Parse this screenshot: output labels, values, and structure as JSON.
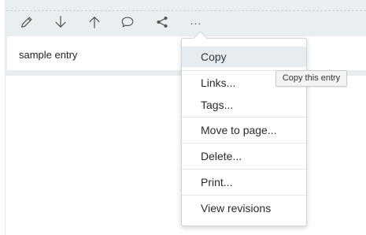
{
  "toolbar": {
    "edit_icon": "pencil-icon",
    "move_down_icon": "arrow-down-icon",
    "move_up_icon": "arrow-up-icon",
    "comment_icon": "speech-bubble-icon",
    "share_icon": "share-icon",
    "more_label": "..."
  },
  "entry": {
    "text": "sample entry"
  },
  "menu": {
    "items": [
      {
        "label": "Copy"
      },
      {
        "label": "Links..."
      },
      {
        "label": "Tags..."
      },
      {
        "label": "Move to page..."
      },
      {
        "label": "Delete..."
      },
      {
        "label": "Print..."
      },
      {
        "label": "View revisions"
      }
    ]
  },
  "tooltip": {
    "text": "Copy this entry"
  },
  "colors": {
    "card_background": "#e9eef1",
    "menu_hover": "#e6ecef",
    "icon": "#555555"
  }
}
